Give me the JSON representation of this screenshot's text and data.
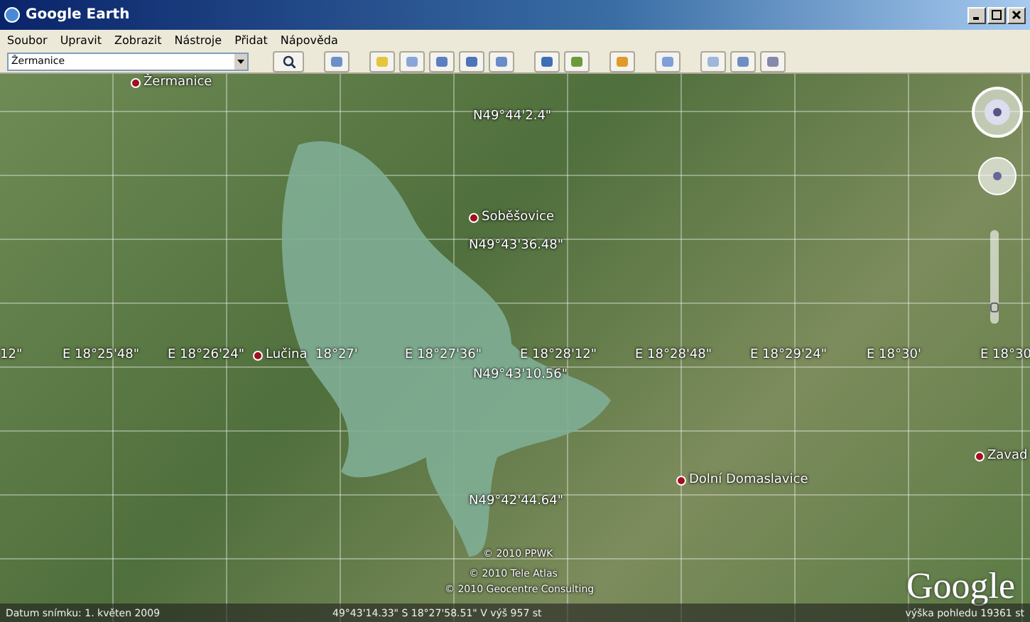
{
  "window": {
    "title": "Google Earth"
  },
  "menu": [
    "Soubor",
    "Upravit",
    "Zobrazit",
    "Nástroje",
    "Přidat",
    "Nápověda"
  ],
  "search": {
    "value": "Žermanice"
  },
  "map": {
    "labels": [
      {
        "kind": "place",
        "text": "Žermanice"
      },
      {
        "kind": "coord",
        "text": "N49°44'2.4\""
      },
      {
        "kind": "place",
        "text": "Soběšovice"
      },
      {
        "kind": "coord",
        "text": "N49°43'36.48\""
      },
      {
        "kind": "coord",
        "text": "12\""
      },
      {
        "kind": "coord",
        "text": "E 18°25'48\""
      },
      {
        "kind": "coord",
        "text": "E 18°26'24\""
      },
      {
        "kind": "place",
        "text": "Lučina"
      },
      {
        "kind": "coord",
        "text": "18°27'"
      },
      {
        "kind": "coord",
        "text": "E 18°27'36\""
      },
      {
        "kind": "coord",
        "text": "E 18°28'12\""
      },
      {
        "kind": "coord",
        "text": "E 18°28'48\""
      },
      {
        "kind": "coord",
        "text": "E 18°29'24\""
      },
      {
        "kind": "coord",
        "text": "E 18°30'"
      },
      {
        "kind": "coord",
        "text": "E 18°30"
      },
      {
        "kind": "coord",
        "text": "N49°43'10.56\""
      },
      {
        "kind": "coord",
        "text": "N49°42'44.64\""
      },
      {
        "kind": "place",
        "text": "Dolní Domaslavice"
      },
      {
        "kind": "place",
        "text": "Zavad"
      },
      {
        "kind": "copyright",
        "text": "© 2010 PPWK"
      },
      {
        "kind": "copyright",
        "text": "© 2010 Tele Atlas"
      },
      {
        "kind": "copyright",
        "text": "© 2010 Geocentre Consulting"
      }
    ],
    "logo": "Google",
    "zoom": {
      "level": 0.15
    }
  },
  "status_bar": {
    "date": "Datum snímku:  1. květen 2009",
    "position": "49°43'14.33\" S   18°27'58.51\" V   výš   957 st",
    "altitude": "výška pohledu   19361 st"
  }
}
